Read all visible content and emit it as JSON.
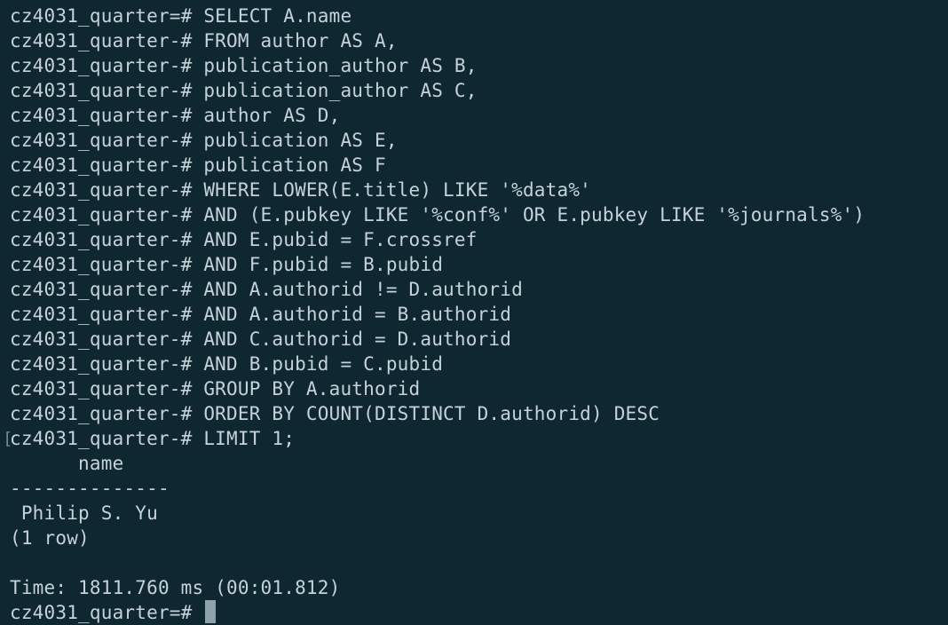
{
  "terminal": {
    "prompt_main": "cz4031_quarter=# ",
    "prompt_cont": "cz4031_quarter-# ",
    "query_lines": [
      "SELECT A.name",
      "FROM author AS A,",
      "publication_author AS B,",
      "publication_author AS C,",
      "author AS D,",
      "publication AS E,",
      "publication AS F",
      "WHERE LOWER(E.title) LIKE '%data%'",
      "AND (E.pubkey LIKE '%conf%' OR E.pubkey LIKE '%journals%')",
      "AND E.pubid = F.crossref",
      "AND F.pubid = B.pubid",
      "AND A.authorid != D.authorid",
      "AND A.authorid = B.authorid",
      "AND C.authorid = D.authorid",
      "AND B.pubid = C.pubid",
      "GROUP BY A.authorid",
      "ORDER BY COUNT(DISTINCT D.authorid) DESC",
      "LIMIT 1;"
    ],
    "result": {
      "header": "      name",
      "separator": "--------------",
      "rows": [
        " Philip S. Yu"
      ],
      "row_count": "(1 row)"
    },
    "timing": "Time: 1811.760 ms (00:01.812)",
    "final_prompt": "cz4031_quarter=# "
  }
}
